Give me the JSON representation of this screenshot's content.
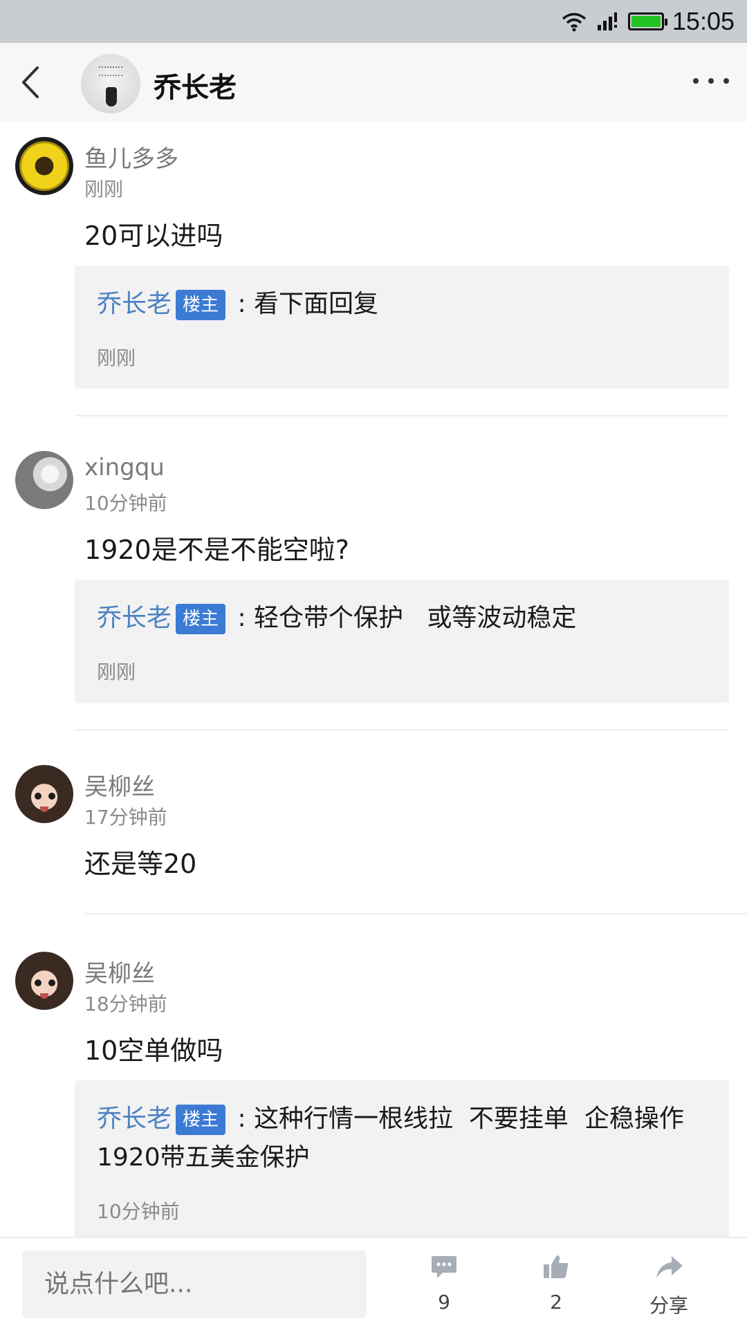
{
  "status_bar": {
    "time": "15:05",
    "battery_color": "#22c322"
  },
  "header": {
    "title": "乔长老",
    "back_icon": "chevron-left-icon",
    "more_icon": "more-icon"
  },
  "comments": [
    {
      "name": "鱼儿多多",
      "time": "刚刚",
      "text": "20可以进吗",
      "reply": {
        "author": "乔长老",
        "badge": "楼主",
        "sep": " : ",
        "text": "看下面回复",
        "time": "刚刚"
      }
    },
    {
      "name": "xingqu",
      "time": "10分钟前",
      "text": "1920是不是不能空啦?",
      "reply": {
        "author": "乔长老",
        "badge": "楼主",
        "sep": " : ",
        "text": "轻仓带个保护   或等波动稳定",
        "time": "刚刚"
      }
    },
    {
      "name": "吴柳丝",
      "time": "17分钟前",
      "text": "还是等20"
    },
    {
      "name": "吴柳丝",
      "time": "18分钟前",
      "text": "10空单做吗",
      "reply": {
        "author": "乔长老",
        "badge": "楼主",
        "sep": " : ",
        "text": "这种行情一根线拉  不要挂单  企稳操作1920带五美金保护",
        "time": "10分钟前"
      }
    }
  ],
  "bottom_bar": {
    "input_placeholder": "说点什么吧...",
    "comment_count": "9",
    "like_count": "2",
    "share_label": "分享"
  },
  "colors": {
    "accent": "#3b7bd4",
    "reply_author": "#4c82c3",
    "reply_bg": "#f2f2f3"
  }
}
